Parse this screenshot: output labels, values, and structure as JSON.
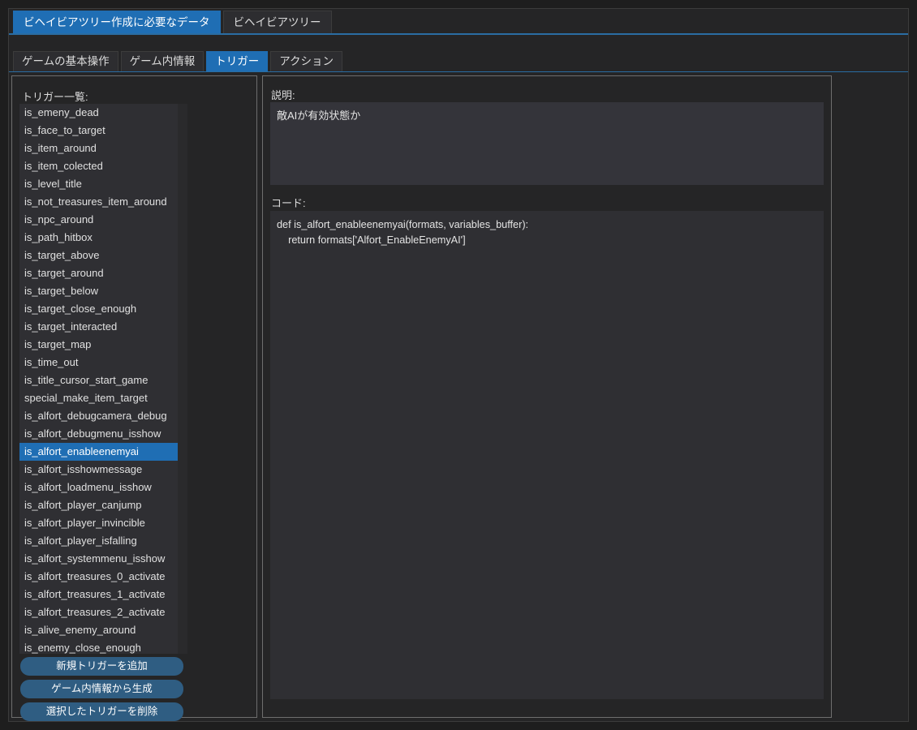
{
  "outer_tabs": [
    {
      "label": "ビヘイビアツリー作成に必要なデータ",
      "selected": true
    },
    {
      "label": "ビヘイビアツリー",
      "selected": false
    }
  ],
  "inner_tabs": [
    {
      "label": "ゲームの基本操作",
      "selected": false
    },
    {
      "label": "ゲーム内情報",
      "selected": false
    },
    {
      "label": "トリガー",
      "selected": true
    },
    {
      "label": "アクション",
      "selected": false
    }
  ],
  "left_panel": {
    "list_label": "トリガー一覧:",
    "selected_item": "is_alfort_enableenemyai",
    "items": [
      "is_emeny_dead",
      "is_face_to_target",
      "is_item_around",
      "is_item_colected",
      "is_level_title",
      "is_not_treasures_item_around",
      "is_npc_around",
      "is_path_hitbox",
      "is_target_above",
      "is_target_around",
      "is_target_below",
      "is_target_close_enough",
      "is_target_interacted",
      "is_target_map",
      "is_time_out",
      "is_title_cursor_start_game",
      "special_make_item_target",
      "is_alfort_debugcamera_debug",
      "is_alfort_debugmenu_isshow",
      "is_alfort_enableenemyai",
      "is_alfort_isshowmessage",
      "is_alfort_loadmenu_isshow",
      "is_alfort_player_canjump",
      "is_alfort_player_invincible",
      "is_alfort_player_isfalling",
      "is_alfort_systemmenu_isshow",
      "is_alfort_treasures_0_activate",
      "is_alfort_treasures_1_activate",
      "is_alfort_treasures_2_activate",
      "is_alive_enemy_around",
      "is_enemy_close_enough"
    ],
    "buttons": {
      "add": "新規トリガーを追加",
      "generate": "ゲーム内情報から生成",
      "delete": "選択したトリガーを削除"
    }
  },
  "right_panel": {
    "description_label": "説明:",
    "description_text": "敵AIが有効状態か",
    "code_label": "コード:",
    "code_text": "def is_alfort_enableenemyai(formats, variables_buffer):\n    return formats['Alfort_EnableEnemyAI']"
  },
  "colors": {
    "accent": "#1f6eb4",
    "button": "#2f5d82",
    "panel_bg": "#252526",
    "list_bg": "#2f2f33",
    "desc_bg": "#34343a",
    "border": "#6e6e6e",
    "window_bg": "#1e1e1e"
  }
}
